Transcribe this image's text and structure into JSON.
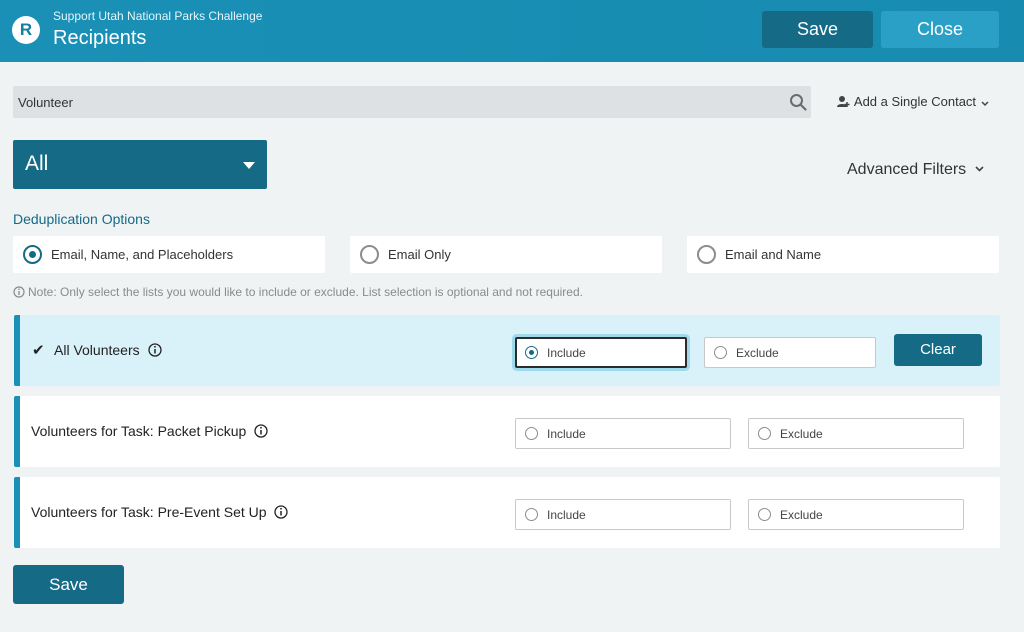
{
  "header": {
    "subtitle": "Support Utah National Parks Challenge",
    "title": "Recipients",
    "logo_letter": "R",
    "save_label": "Save",
    "close_label": "Close"
  },
  "search": {
    "value": "Volunteer",
    "icon": "search-icon"
  },
  "add_contact": {
    "label": "Add a Single Contact",
    "icon": "add-person-icon"
  },
  "list_filter": {
    "selected": "All"
  },
  "advanced_filters": {
    "label": "Advanced Filters"
  },
  "dedup": {
    "title": "Deduplication Options",
    "options": [
      {
        "label": "Email, Name, and Placeholders",
        "selected": true
      },
      {
        "label": "Email Only",
        "selected": false
      },
      {
        "label": "Email and Name",
        "selected": false
      }
    ]
  },
  "note": "Note: Only select the lists you would like to include or exclude. List selection is optional and not required.",
  "lists": [
    {
      "name": "All Volunteers",
      "checked": true,
      "include_label": "Include",
      "exclude_label": "Exclude",
      "choice": "include",
      "clear_label": "Clear"
    },
    {
      "name": "Volunteers for Task: Packet Pickup",
      "checked": false,
      "include_label": "Include",
      "exclude_label": "Exclude",
      "choice": ""
    },
    {
      "name": "Volunteers for Task: Pre-Event Set Up",
      "checked": false,
      "include_label": "Include",
      "exclude_label": "Exclude",
      "choice": ""
    }
  ],
  "footer": {
    "save_label": "Save"
  },
  "colors": {
    "header": "#1a90b6",
    "primary_dark": "#156a86",
    "close_button": "#2aa0c6",
    "active_row": "#d9f1f9",
    "page_bg": "#f0f3f4"
  }
}
